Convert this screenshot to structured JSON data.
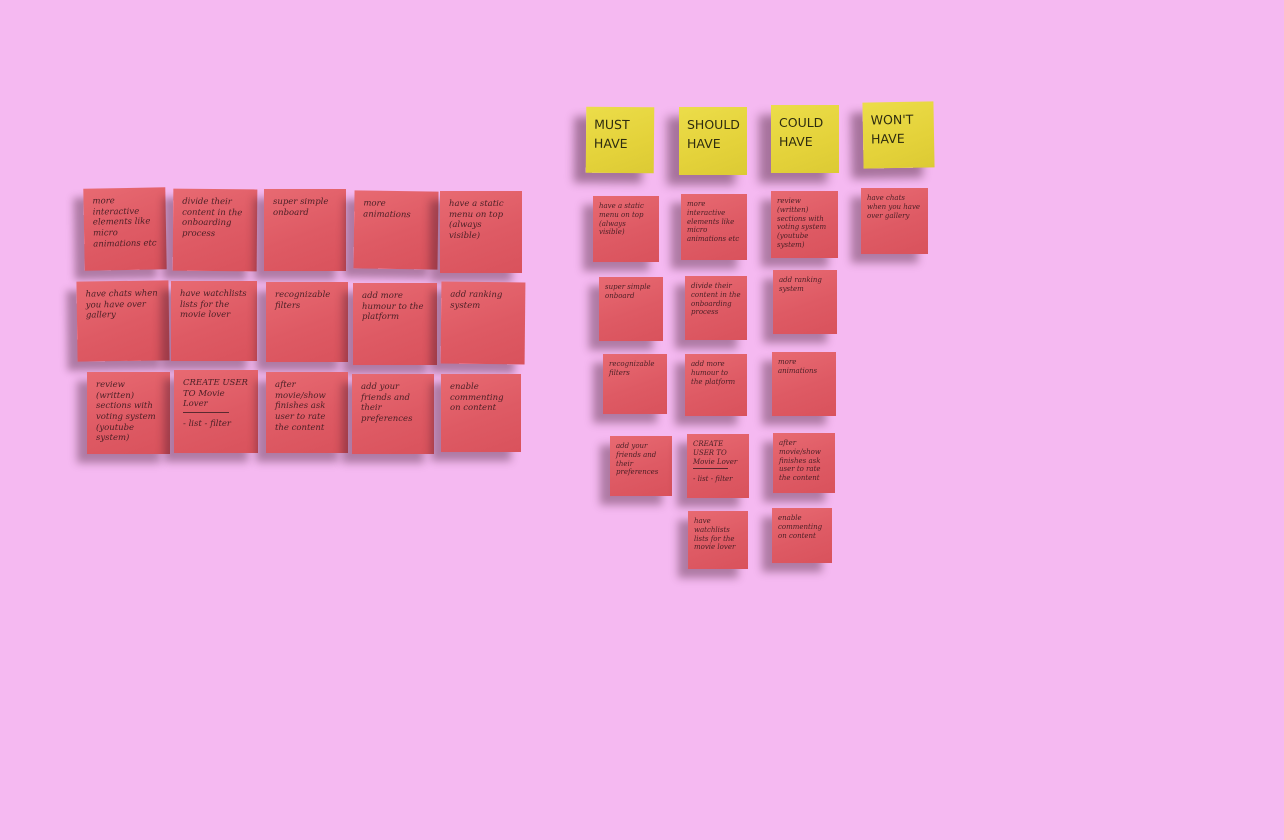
{
  "background_color": "#f5b9f1",
  "note_color": "#de5a64",
  "header_color": "#e4d23a",
  "headers": {
    "must": "MUST HAVE",
    "should": "SHOULD HAVE",
    "could": "COULD HAVE",
    "wont": "WON'T HAVE"
  },
  "left_notes": {
    "r1c1": "more interactive elements like micro animations etc",
    "r1c2": "divide their content in the onboarding process",
    "r1c3": "super simple onboard",
    "r1c4": "more animations",
    "r1c5": "have a static menu on top (always visible)",
    "r2c1": "have chats when you have over gallery",
    "r2c2": "have watchlists lists for the movie lover",
    "r2c3": "recognizable filters",
    "r2c4": "add more humour to the platform",
    "r2c5": "add ranking system",
    "r3c1": "review (written) sections with voting system (youtube system)",
    "r3c2": "CREATE USER TO Movie Lover",
    "r3c2_sub": "- list - filter",
    "r3c3": "after movie/show finishes ask user to rate the content",
    "r3c4": "add your friends and their preferences",
    "r3c5": "enable commenting on content"
  },
  "must_notes": {
    "m1": "have a static menu on top (always visible)",
    "m2": "super simple onboard",
    "m3": "recognizable filters",
    "m4": "add your friends and their preferences"
  },
  "should_notes": {
    "s1": "more interactive elements like micro animations etc",
    "s2": "divide their content in the onboarding process",
    "s3": "add more humour to the platform",
    "s4": "CREATE USER TO Movie Lover",
    "s4_sub": "- list - filter",
    "s5": "have watchlists lists for the movie lover"
  },
  "could_notes": {
    "c1": "review (written) sections with voting system (youtube system)",
    "c2": "add ranking system",
    "c3": "more animations",
    "c4": "after movie/show finishes ask user to rate the content",
    "c5": "enable commenting on content"
  },
  "wont_notes": {
    "w1": "have chats when you have over gallery"
  }
}
